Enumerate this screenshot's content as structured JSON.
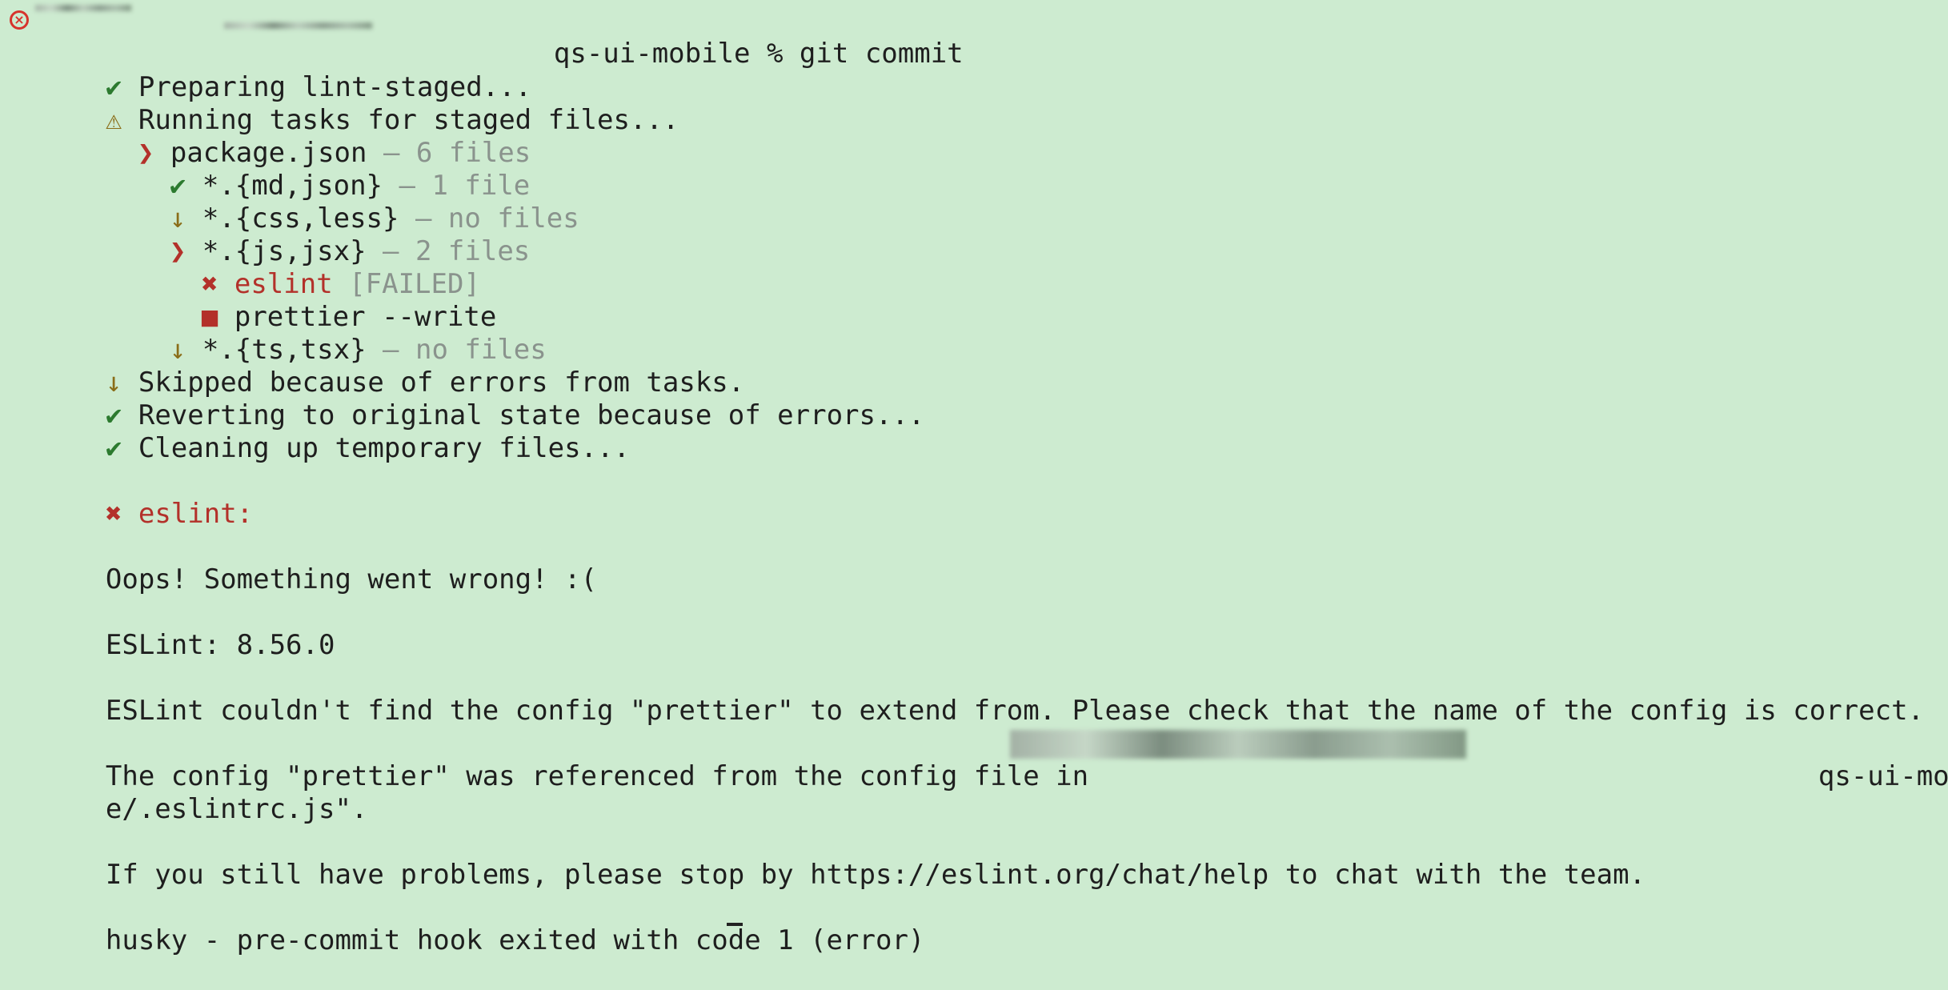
{
  "terminal": {
    "prompt_command": "qs-ui-mobile % git commit",
    "lines": {
      "preparing": {
        "icon": "✔",
        "text": "Preparing lint-staged..."
      },
      "running": {
        "icon": "⚠",
        "text": "Running tasks for staged files..."
      },
      "package": {
        "icon": "❯",
        "text": "package.json",
        "suffix": " — 6 files"
      },
      "md_json": {
        "icon": "✔",
        "text": "*.{md,json}",
        "suffix": " — 1 file"
      },
      "css_less": {
        "icon": "↓",
        "text": "*.{css,less}",
        "suffix": " — no files"
      },
      "js_jsx": {
        "icon": "❯",
        "text": "*.{js,jsx}",
        "suffix": " — 2 files"
      },
      "eslint_task": {
        "icon": "✖",
        "text": "eslint",
        "suffix": " [FAILED]"
      },
      "prettier_task": {
        "icon": "■",
        "text": "prettier --write"
      },
      "ts_tsx": {
        "icon": "↓",
        "text": "*.{ts,tsx}",
        "suffix": " — no files"
      },
      "skipped": {
        "icon": "↓",
        "text": "Skipped because of errors from tasks."
      },
      "reverting": {
        "icon": "✔",
        "text": "Reverting to original state because of errors..."
      },
      "cleaning": {
        "icon": "✔",
        "text": "Cleaning up temporary files..."
      },
      "eslint_header": {
        "icon": "✖",
        "text": "eslint:"
      },
      "oops": "Oops! Something went wrong! :(",
      "eslint_version": "ESLint: 8.56.0",
      "config_error": "ESLint couldn't find the config \"prettier\" to extend from. Please check that the name of the config is correct.",
      "referenced_prefix": "The config \"prettier\" was referenced from the config file in ",
      "referenced_suffix": "qs-ui-mobil",
      "referenced_cont": "e/.eslintrc.js\".",
      "help": "If you still have problems, please stop by https://eslint.org/chat/help to chat with the team.",
      "husky": "husky - pre-commit hook exited with code 1 (error)"
    }
  },
  "colors": {
    "background": "#cdebd0",
    "success": "#2c7a2f",
    "warning": "#8a6d18",
    "error": "#b3312a",
    "muted": "#8a938d"
  }
}
